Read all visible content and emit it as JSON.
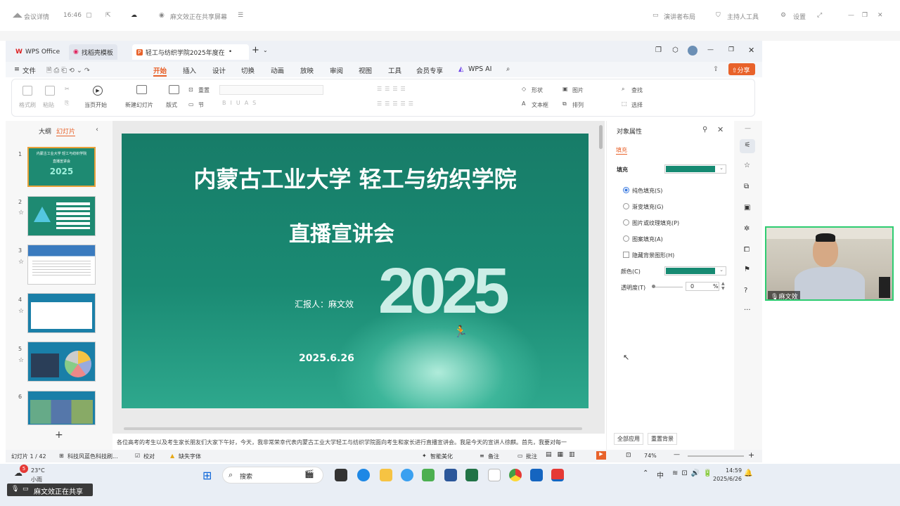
{
  "meeting_bar": {
    "title": "会议详情",
    "time": "16:46",
    "sharer": "麻文效正在共享屏幕",
    "layout": "演讲者布局",
    "host": "主持人工具",
    "settings": "设置"
  },
  "tabs": [
    {
      "label": "WPS Office"
    },
    {
      "label": "找稻壳模板"
    },
    {
      "label": "轻工与纺织学院2025年度在..."
    }
  ],
  "menu": {
    "file": "文件",
    "items": [
      "开始",
      "插入",
      "设计",
      "切换",
      "动画",
      "放映",
      "审阅",
      "视图",
      "工具",
      "会员专享",
      "WPS AI"
    ],
    "share": "分享"
  },
  "ribbon": {
    "format_painter": "格式刷",
    "paste": "粘贴",
    "from_current": "当页开始",
    "new_slide": "新建幻灯片",
    "layout": "版式",
    "section": "节",
    "reset": "重置",
    "shape": "形状",
    "picture": "图片",
    "textbox": "文本框",
    "arrange": "排列",
    "find": "查找",
    "select": "选择"
  },
  "left_panel": {
    "outline": "大纲",
    "slides": "幻灯片",
    "add": "+",
    "slide_numbers": [
      "1",
      "2",
      "3",
      "4",
      "5",
      "6"
    ]
  },
  "slide": {
    "title1": "内蒙古工业大学  轻工与纺织学院",
    "title2": "直播宣讲会",
    "reporter": "汇报人：麻文效",
    "year": "2025",
    "date": "2025.6.26"
  },
  "notes": "各位高考的考生以及考生家长朋友们大家下午好，今天，我非常荣幸代表内蒙古工业大学轻工与纺织学院面向考生和家长进行直播宣讲会。我是今天的宣讲人徐麒。首先，我要对每一",
  "properties": {
    "header": "对象属性",
    "fill_tab": "填充",
    "fill": "填充",
    "solid": "纯色填充(S)",
    "gradient": "渐变填充(G)",
    "picture": "图片或纹理填充(P)",
    "pattern": "图案填充(A)",
    "hide_bg": "隐藏背景图形(H)",
    "color": "颜色(C)",
    "transparency": "透明度(T)",
    "transparency_value": "0",
    "percent": "%",
    "apply_all": "全部应用",
    "reset_bg": "重置背景",
    "fill_color": "#168a72"
  },
  "status": {
    "slide": "幻灯片 1 / 42",
    "theme": "科技风蓝色科技刷...",
    "proof": "校对",
    "missing_font": "缺失字体",
    "beautify": "智能美化",
    "notes": "备注",
    "comment": "批注",
    "zoom": "74%"
  },
  "taskbar": {
    "temp": "23°C",
    "weather": "小雨",
    "search": "搜索",
    "ime": "中",
    "clock": "14:59",
    "date": "2025/6/26",
    "badge": "5"
  },
  "share_notice": "麻文效正在共享",
  "video": {
    "name": "麻文效"
  }
}
